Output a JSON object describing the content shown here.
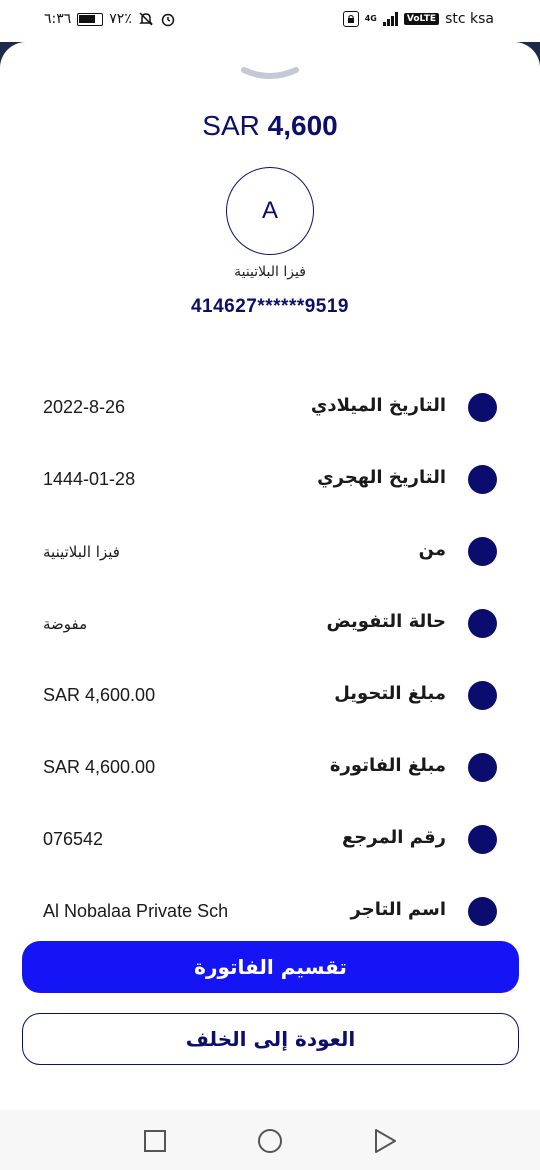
{
  "status_bar": {
    "time": "٦:٣٦",
    "battery": "٧٢٪",
    "network": "4G",
    "volte": "VoLTE",
    "carrier": "stc ksa"
  },
  "transaction": {
    "amount_currency": "SAR",
    "amount_value": "4,600",
    "avatar_letter": "A",
    "card_name": "فيزا البلاتينية",
    "card_number": "414627******9519"
  },
  "details": [
    {
      "label": "التاريخ الميلادي",
      "value": "2022-8-26"
    },
    {
      "label": "التاريخ الهجري",
      "value": "1444-01-28"
    },
    {
      "label": "من",
      "value": "فيزا البلاتينية"
    },
    {
      "label": "حالة التفويض",
      "value": "مفوضة"
    },
    {
      "label": "مبلغ التحويل",
      "value": "SAR 4,600.00"
    },
    {
      "label": "مبلغ الفاتورة",
      "value": "SAR 4,600.00"
    },
    {
      "label": "رقم المرجع",
      "value": "076542"
    },
    {
      "label": "اسم التاجر",
      "value": "Al Nobalaa Private Sch"
    }
  ],
  "actions": {
    "split_bill": "تقسيم الفاتورة",
    "go_back": "العودة إلى الخلف"
  },
  "colors": {
    "brand_navy": "#0c0e6b",
    "primary_button": "#1414f5",
    "dot": "#0a0c6e"
  },
  "icons": [
    "alarm-icon",
    "mute-icon",
    "battery-icon",
    "lock-icon",
    "signal-icon",
    "chevron-down-icon",
    "square-icon",
    "circle-icon",
    "triangle-icon"
  ]
}
